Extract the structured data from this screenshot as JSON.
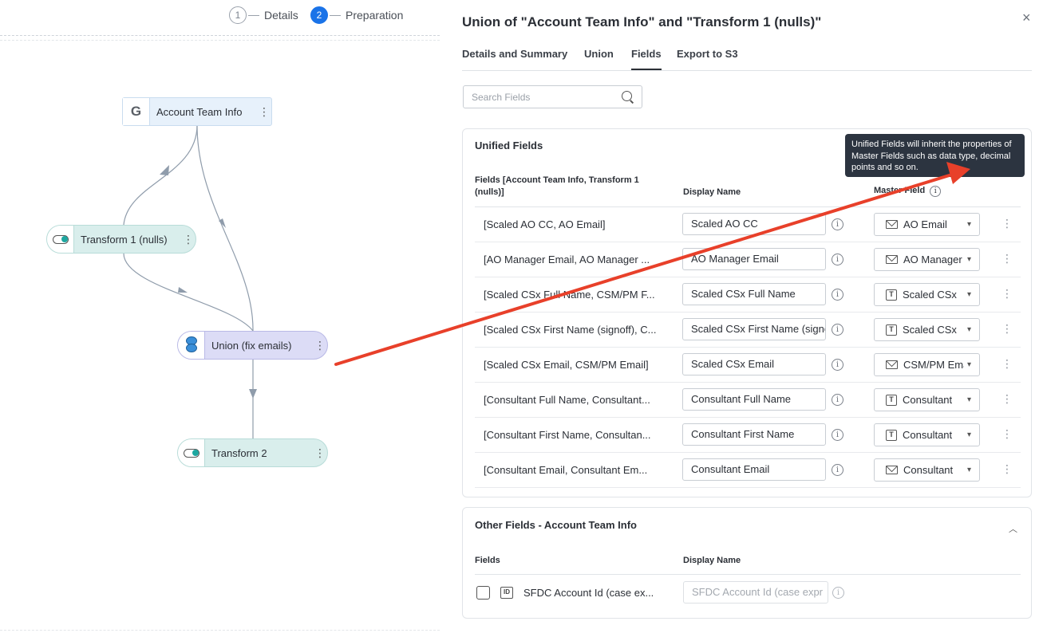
{
  "stepper": {
    "steps": [
      {
        "number": "1",
        "label": "Details"
      },
      {
        "number": "2",
        "label": "Preparation"
      }
    ]
  },
  "flow": {
    "nodes": [
      {
        "label": "Account Team Info",
        "icon": "G"
      },
      {
        "label": "Transform 1 (nulls)"
      },
      {
        "label": "Union (fix emails)"
      },
      {
        "label": "Transform 2"
      }
    ]
  },
  "panel": {
    "title": "Union of \"Account Team Info\" and \"Transform 1 (nulls)\"",
    "close": "×",
    "tabs": [
      "Details and Summary",
      "Union",
      "Fields",
      "Export to S3"
    ],
    "search_placeholder": "Search Fields",
    "unified": {
      "title": "Unified Fields",
      "col_fields": "Fields [Account Team Info, Transform 1 (nulls)]",
      "col_display": "Display Name",
      "col_master": "Master Field",
      "tooltip": "Unified Fields will inherit the properties of Master Fields such as data type, decimal points and so on.",
      "rows": [
        {
          "fields": "[Scaled AO CC, AO Email]",
          "display": "Scaled AO CC",
          "master": "AO Email",
          "master_icon": "mail-icon"
        },
        {
          "fields": "[AO Manager Email, AO Manager ...",
          "display": "AO Manager Email",
          "master": "AO Manager",
          "master_icon": "mail-icon"
        },
        {
          "fields": "[Scaled CSx Full Name, CSM/PM F...",
          "display": "Scaled CSx Full Name",
          "master": "Scaled CSx",
          "master_icon": "text-icon"
        },
        {
          "fields": "[Scaled CSx First Name (signoff), C...",
          "display": "Scaled CSx First Name (signoff)",
          "master": "Scaled CSx",
          "master_icon": "text-icon"
        },
        {
          "fields": "[Scaled CSx Email, CSM/PM Email]",
          "display": "Scaled CSx Email",
          "master": "CSM/PM Email",
          "master_icon": "mail-icon"
        },
        {
          "fields": "[Consultant Full Name, Consultant...",
          "display": "Consultant Full Name",
          "master": "Consultant",
          "master_icon": "text-icon"
        },
        {
          "fields": "[Consultant First Name, Consultan...",
          "display": "Consultant First Name",
          "master": "Consultant",
          "master_icon": "text-icon"
        },
        {
          "fields": "[Consultant Email, Consultant Em...",
          "display": "Consultant Email",
          "master": "Consultant",
          "master_icon": "mail-icon"
        }
      ]
    },
    "other": {
      "title": "Other Fields - Account Team Info",
      "col_fields": "Fields",
      "col_display": "Display Name",
      "rows": [
        {
          "field": "SFDC Account Id (case ex...",
          "display_placeholder": "SFDC Account Id (case expr",
          "type_icon": "ID"
        }
      ]
    }
  },
  "colors": {
    "accent": "#1a73e8",
    "annotation_arrow": "#e8402a",
    "tooltip_bg": "#2c3440"
  }
}
